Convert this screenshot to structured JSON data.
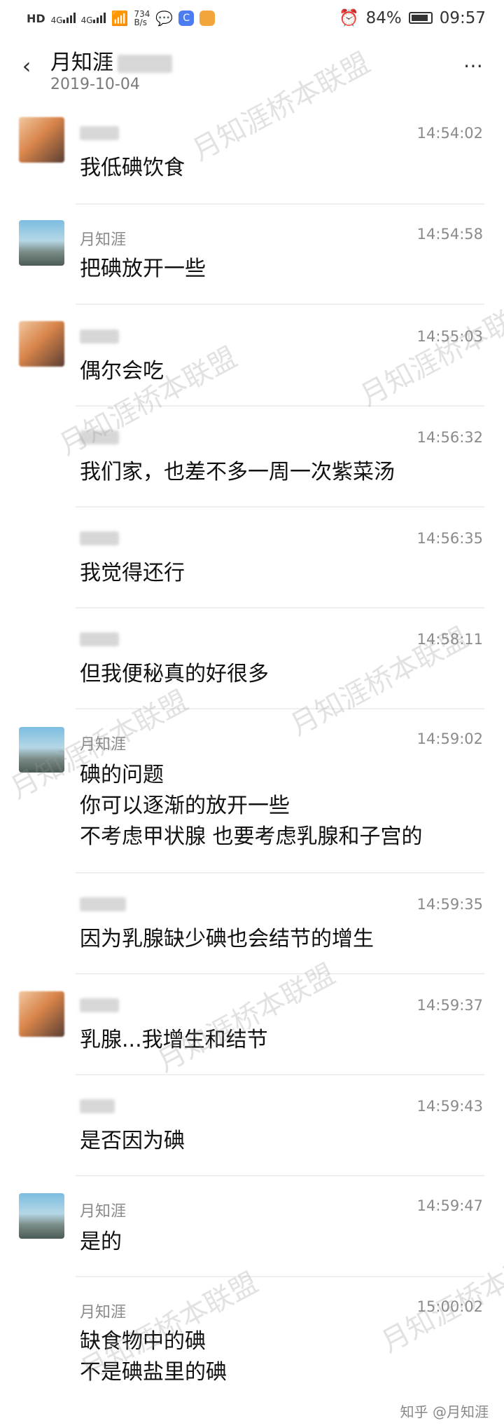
{
  "status": {
    "hd": "HD",
    "signal1": "4G",
    "signal2": "4G",
    "speed_top": "734",
    "speed_unit": "B/s",
    "app_c": "C",
    "battery": "84%",
    "time": "09:57"
  },
  "header": {
    "title": "月知涯",
    "date": "2019-10-04"
  },
  "watermark": "月知涯桥本联盟",
  "messages": [
    {
      "sender": "",
      "time": "14:54:02",
      "lines": [
        "我低碘饮食"
      ]
    },
    {
      "sender": "月知涯",
      "time": "14:54:58",
      "lines": [
        "把碘放开一些"
      ]
    },
    {
      "sender": "",
      "time": "14:55:03",
      "lines": [
        "偶尔会吃"
      ]
    },
    {
      "sender": "",
      "time": "14:56:32",
      "lines": [
        "我们家，也差不多一周一次紫菜汤"
      ]
    },
    {
      "sender": "",
      "time": "14:56:35",
      "lines": [
        "我觉得还行"
      ]
    },
    {
      "sender": "",
      "time": "14:58:11",
      "lines": [
        "但我便秘真的好很多"
      ]
    },
    {
      "sender": "月知涯",
      "time": "14:59:02",
      "lines": [
        "碘的问题",
        "你可以逐渐的放开一些",
        "不考虑甲状腺 也要考虑乳腺和子宫的"
      ]
    },
    {
      "sender": "",
      "time": "14:59:35",
      "lines": [
        "因为乳腺缺少碘也会结节的增生"
      ]
    },
    {
      "sender": "",
      "time": "14:59:37",
      "lines": [
        "乳腺...我增生和结节"
      ]
    },
    {
      "sender": "",
      "time": "14:59:43",
      "lines": [
        "是否因为碘"
      ]
    },
    {
      "sender": "月知涯",
      "time": "14:59:47",
      "lines": [
        "是的"
      ]
    },
    {
      "sender": "月知涯",
      "time": "15:00:02",
      "lines": [
        "缺食物中的碘",
        "不是碘盐里的碘"
      ]
    }
  ],
  "footer": "知乎 @月知涯"
}
